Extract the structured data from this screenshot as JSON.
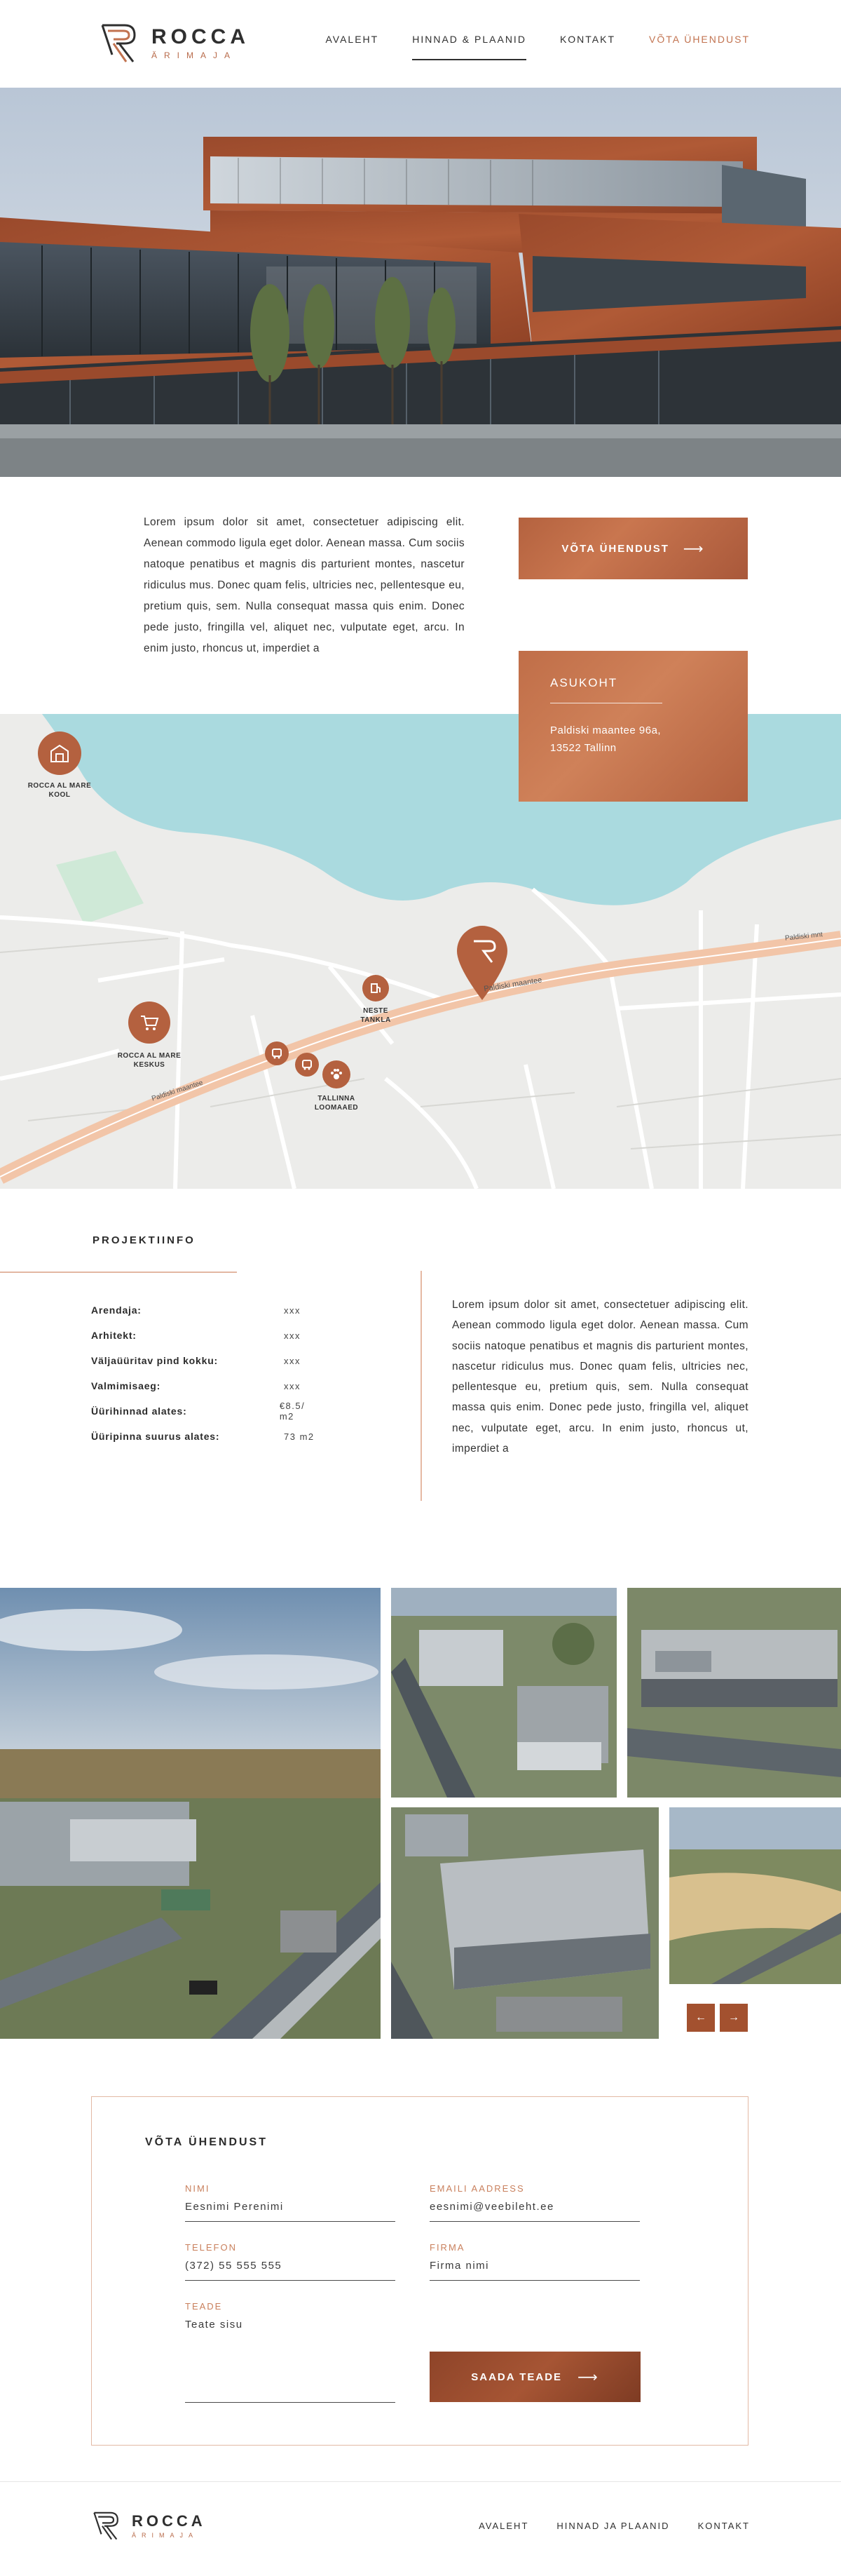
{
  "header": {
    "logo_name": "ROCCA",
    "logo_sub": "ÄRIMAJA",
    "nav": [
      {
        "label": "AVALEHT"
      },
      {
        "label": "HINNAD & PLAANID"
      },
      {
        "label": "KONTAKT"
      },
      {
        "label": "VÕTA ÜHENDUST"
      }
    ]
  },
  "intro": {
    "text": "Lorem ipsum dolor sit amet, consectetuer adipiscing elit. Aenean commodo ligula eget dolor. Aenean massa. Cum sociis natoque penatibus et magnis dis parturient montes, nascetur ridiculus mus. Donec quam felis, ultricies nec, pellentesque eu, pretium quis, sem. Nulla consequat massa quis enim. Donec pede justo, fringilla vel, aliquet nec, vulputate eget, arcu. In enim justo, rhoncus ut, imperdiet a",
    "cta_label": "VÕTA ÜHENDUST",
    "cta_arrow": "⟶"
  },
  "address": {
    "title": "ASUKOHT",
    "line1": "Paldiski maantee 96a,",
    "line2": "13522 Tallinn"
  },
  "map": {
    "labels": {
      "school": "ROCCA AL MARE\nKOOL",
      "center": "ROCCA AL MARE\nKESKUS",
      "neste": "NESTE\nTANKLA",
      "zoo": "TALLINNA\nLOOMAAED",
      "road1": "Paldiski maantee",
      "road2": "Paldiski maantee",
      "road3": "Paldiski mnt"
    }
  },
  "project": {
    "title": "PROJEKTIINFO",
    "rows": [
      {
        "label": "Arendaja:",
        "value": "xxx"
      },
      {
        "label": "Arhitekt:",
        "value": "xxx"
      },
      {
        "label": "Väljaüüritav pind kokku:",
        "value": "xxx"
      },
      {
        "label": "Valmimisaeg:",
        "value": "xxx"
      },
      {
        "label": "Üürihinnad alates:",
        "value": "€8.5/ m2"
      },
      {
        "label": "Üüripinna suurus alates:",
        "value": "73 m2"
      }
    ],
    "text": "Lorem ipsum dolor sit amet, consectetuer adipiscing elit. Aenean commodo ligula eget dolor. Aenean massa. Cum sociis natoque penatibus et magnis dis parturient montes, nascetur ridiculus mus. Donec quam felis, ultricies nec, pellentesque eu, pretium quis, sem. Nulla consequat massa quis enim. Donec pede justo, fringilla vel, aliquet nec, vulputate eget, arcu. In enim justo, rhoncus ut, imperdiet a"
  },
  "gallery": {
    "prev": "←",
    "next": "→"
  },
  "contact": {
    "title": "VÕTA ÜHENDUST",
    "fields": {
      "name": {
        "label": "NIMI",
        "value": "Eesnimi Perenimi"
      },
      "email": {
        "label": "EMAILI AADRESS",
        "value": "eesnimi@veebileht.ee"
      },
      "phone": {
        "label": "TELEFON",
        "value": "(372) 55 555 555"
      },
      "company": {
        "label": "FIRMA",
        "value": "Firma nimi"
      },
      "message": {
        "label": "TEADE",
        "value": "Teate sisu"
      }
    },
    "send_label": "SAADA TEADE",
    "send_arrow": "⟶"
  },
  "footer": {
    "logo_name": "ROCCA",
    "logo_sub": "ÄRIMAJA",
    "nav": [
      {
        "label": "AVALEHT"
      },
      {
        "label": "HINNAD JA PLAANID"
      },
      {
        "label": "KONTAKT"
      }
    ]
  },
  "colors": {
    "accent": "#c27350",
    "accent_dark": "#a3512f",
    "text": "#2b2b2b"
  }
}
